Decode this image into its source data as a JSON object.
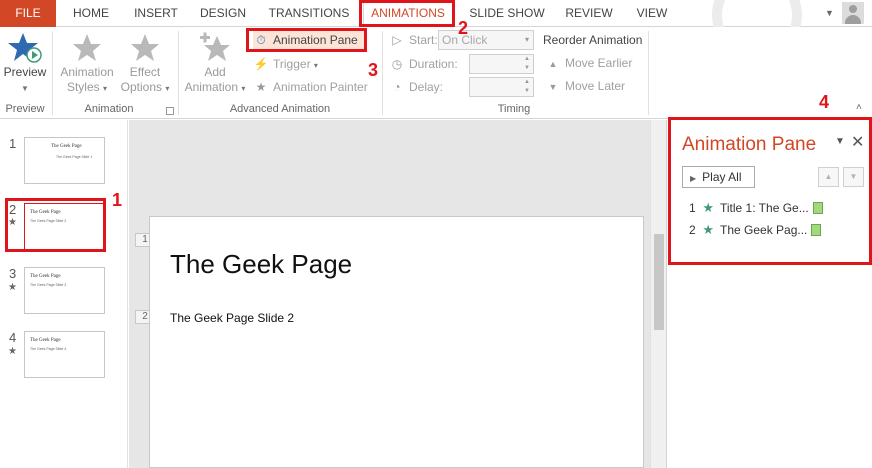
{
  "tabs": [
    {
      "label": "FILE"
    },
    {
      "label": "HOME"
    },
    {
      "label": "INSERT"
    },
    {
      "label": "DESIGN"
    },
    {
      "label": "TRANSITIONS"
    },
    {
      "label": "ANIMATIONS"
    },
    {
      "label": "SLIDE SHOW"
    },
    {
      "label": "REVIEW"
    },
    {
      "label": "VIEW"
    }
  ],
  "active_tab": "ANIMATIONS",
  "ribbon": {
    "preview": {
      "label": "Preview",
      "group": "Preview"
    },
    "animation_styles": {
      "label1": "Animation",
      "label2": "Styles"
    },
    "effect_options": {
      "label1": "Effect",
      "label2": "Options"
    },
    "animation_group": "Animation",
    "add_animation": {
      "label1": "Add",
      "label2": "Animation"
    },
    "animation_pane": "Animation Pane",
    "trigger": "Trigger",
    "animation_painter": "Animation Painter",
    "advanced_group": "Advanced Animation",
    "start_label": "Start:",
    "start_value": "On Click",
    "duration_label": "Duration:",
    "delay_label": "Delay:",
    "timing_group": "Timing",
    "reorder_title": "Reorder Animation",
    "move_earlier": "Move Earlier",
    "move_later": "Move Later"
  },
  "thumbnails": [
    {
      "num": "1",
      "title": "The Geek Page",
      "sub": "The Geek Page Slide 1",
      "has_anim": false
    },
    {
      "num": "2",
      "title": "The Geek Page",
      "sub": "The Geek Page Slide 2",
      "has_anim": true
    },
    {
      "num": "3",
      "title": "The Geek Page",
      "sub": "The Geek Page Slide 3",
      "has_anim": true
    },
    {
      "num": "4",
      "title": "The Geek Page",
      "sub": "The Geek Page Slide 4",
      "has_anim": true
    }
  ],
  "slide": {
    "title": "The Geek Page",
    "subtitle": "The Geek Page Slide 2",
    "tag1": "1",
    "tag2": "2"
  },
  "animation_pane": {
    "title": "Animation Pane",
    "play_all": "Play All",
    "items": [
      {
        "index": "1",
        "label": "Title 1: The Ge..."
      },
      {
        "index": "2",
        "label": "The Geek Pag..."
      }
    ]
  },
  "callouts": [
    "1",
    "2",
    "3",
    "4"
  ],
  "colors": {
    "accent": "#d24726",
    "highlight": "#e0151c",
    "anim_star": "#3f9a7a",
    "anim_bar": "#a6d77f"
  }
}
